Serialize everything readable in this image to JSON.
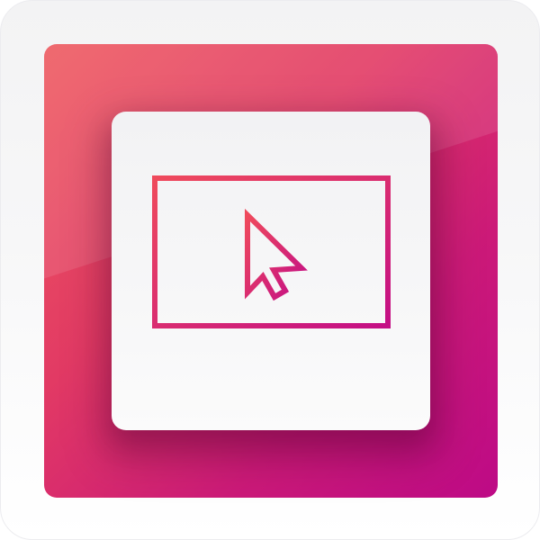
{
  "icon": {
    "name": "computer-monitor-cursor-icon",
    "colors": {
      "gradient_start": "#ee5a5f",
      "gradient_mid": "#e23a64",
      "gradient_end": "#bd0a86",
      "card_bg": "#f7f7f8",
      "stroke_start": "#ef4a5c",
      "stroke_end": "#c40f85"
    }
  }
}
